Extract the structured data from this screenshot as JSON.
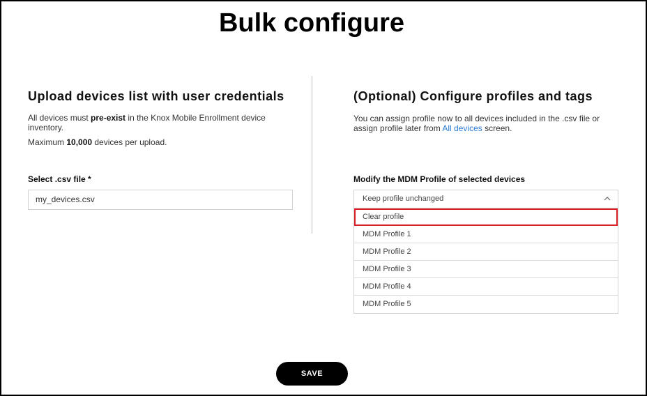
{
  "page": {
    "title": "Bulk configure"
  },
  "upload": {
    "heading": "Upload devices list with user credentials",
    "desc_prefix": "All devices must ",
    "desc_bold": "pre-exist",
    "desc_suffix": " in the Knox Mobile Enrollment device inventory.",
    "max_prefix": "Maximum ",
    "max_bold": "10,000",
    "max_suffix": " devices per upload.",
    "file_label": "Select .csv file *",
    "file_value": "my_devices.csv"
  },
  "profiles": {
    "heading": "(Optional) Configure profiles and tags",
    "desc_prefix": "You can assign profile now to all devices included in the .csv file or assign profile later from ",
    "desc_link": "All devices",
    "desc_suffix": " screen.",
    "mdm_label": "Modify the MDM Profile of selected devices",
    "selected": "Keep profile unchanged",
    "options": [
      "Clear profile",
      "MDM Profile 1",
      "MDM Profile 2",
      "MDM Profile 3",
      "MDM Profile 4",
      "MDM Profile 5"
    ],
    "highlighted_option": "Clear profile",
    "highlight_color": "#d81f26",
    "link_color": "#2a7bd6"
  },
  "footer": {
    "save_label": "SAVE"
  }
}
